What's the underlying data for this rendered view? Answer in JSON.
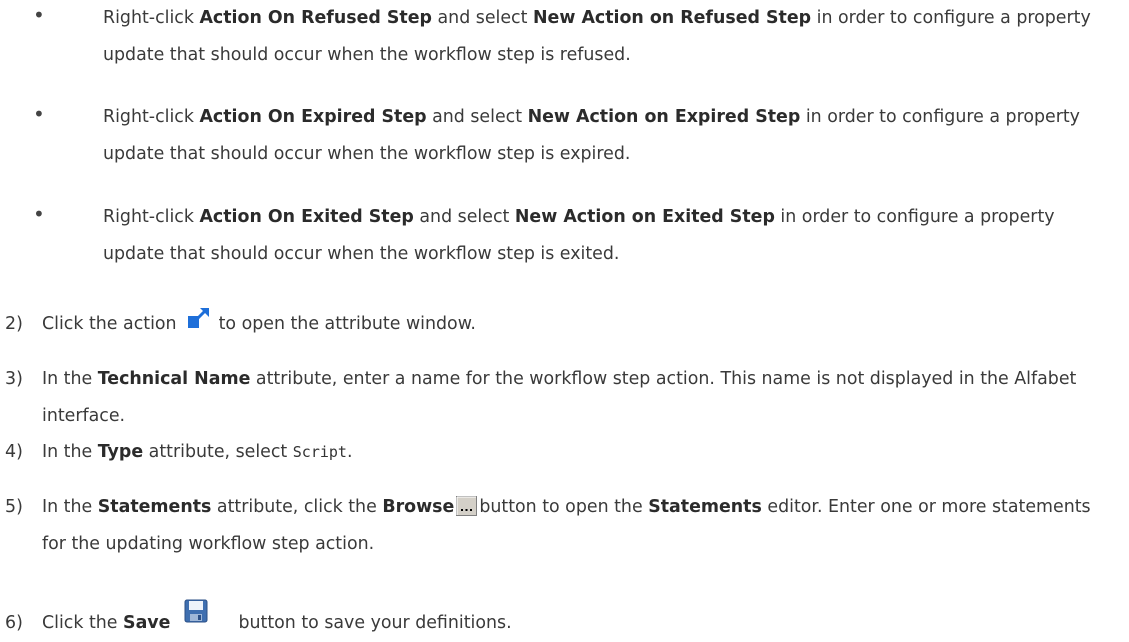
{
  "bullets": [
    {
      "pre": "Right-click ",
      "b1": "Action On Refused Step",
      "mid": " and select ",
      "b2": "New Action on Refused Step",
      "post": " in order to configure a property update that should occur when the workflow step is refused."
    },
    {
      "pre": "Right-click ",
      "b1": "Action On Expired Step",
      "mid": " and select ",
      "b2": "New Action on Expired Step",
      "post": " in order to configure a property update that should occur when the workflow step is expired."
    },
    {
      "pre": "Right-click ",
      "b1": "Action On Exited Step",
      "mid": " and select ",
      "b2": "New Action on Exited Step",
      "post": " in order to configure a property update that should occur when the workflow step is exited."
    }
  ],
  "bullet_char": "•",
  "steps": {
    "s2": {
      "num": "2)",
      "pre": "Click the action",
      "post": "to open the attribute window."
    },
    "s3": {
      "num": "3)",
      "pre": "In the ",
      "bold": "Technical Name",
      "post": " attribute, enter a name for the workflow step action. This name is not displayed in the Alfabet interface."
    },
    "s4": {
      "num": "4)",
      "pre": "In the ",
      "bold": "Type",
      "mid": " attribute, select ",
      "code": "Script",
      "post": "."
    },
    "s5": {
      "num": "5)",
      "pre": "In the ",
      "bold1": "Statements",
      "mid1": " attribute, click the ",
      "bold2": "Browse",
      "mid2": "button to open the ",
      "bold3": "Statements",
      "post": " editor. Enter one or more statements for the updating workflow step action."
    },
    "s6": {
      "num": "6)",
      "pre": "Click the ",
      "bold": "Save",
      "post": "button to save your definitions."
    }
  },
  "icons": {
    "open": "open-attribute-window-icon",
    "browse": "browse-ellipsis-icon",
    "save": "save-floppy-icon"
  },
  "colors": {
    "text": "#3a3a3a",
    "open_icon_blue": "#1e6fd9",
    "save_icon_blue": "#3f6fb0"
  }
}
